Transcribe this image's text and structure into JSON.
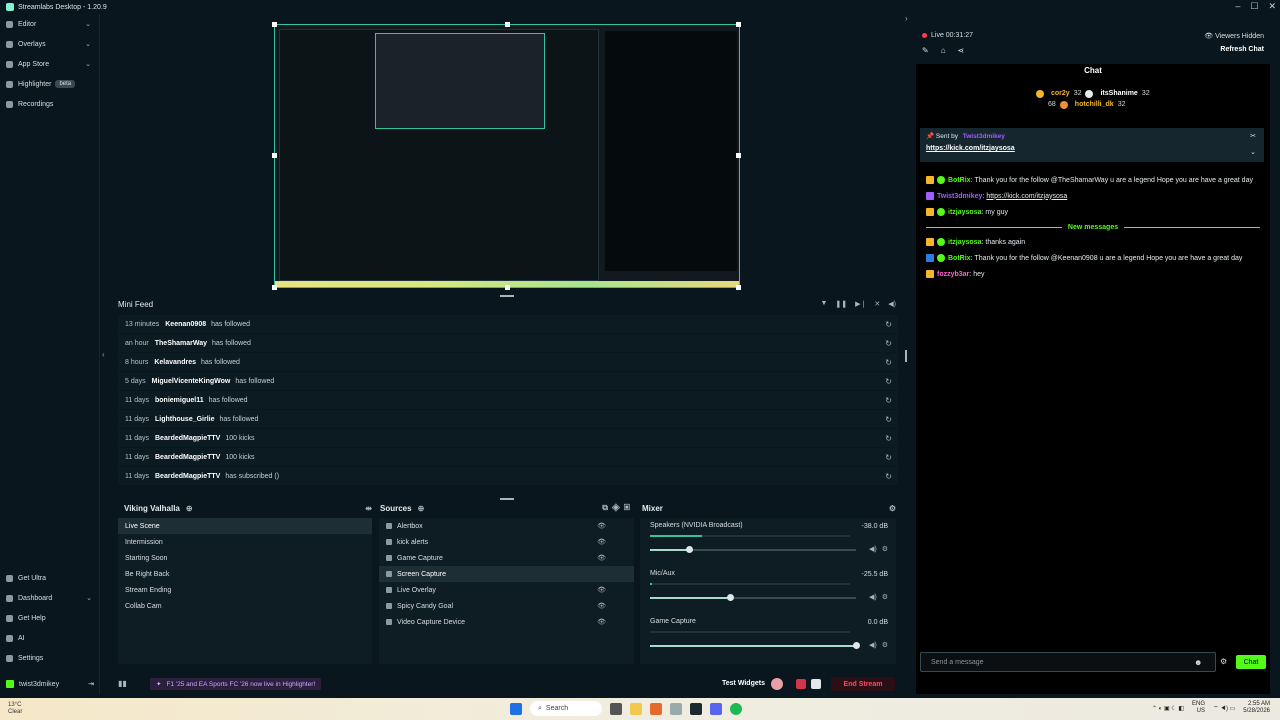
{
  "app": {
    "title": "Streamlabs Desktop - 1.20.9"
  },
  "sidebar": {
    "top": [
      {
        "label": "Editor",
        "chevron": true
      },
      {
        "label": "Overlays",
        "chevron": true
      },
      {
        "label": "App Store",
        "chevron": true
      },
      {
        "label": "Highlighter",
        "badge": "beta"
      },
      {
        "label": "Recordings"
      }
    ],
    "bottom": [
      {
        "label": "Get Ultra"
      },
      {
        "label": "Dashboard",
        "chevron": true
      },
      {
        "label": "Get Help"
      },
      {
        "label": "AI"
      },
      {
        "label": "Settings"
      }
    ],
    "user": "twist3dmikey"
  },
  "minifeed": {
    "title": "Mini Feed",
    "rows": [
      {
        "time": "13 minutes",
        "name": "Keenan0908",
        "action": "has followed"
      },
      {
        "time": "an hour",
        "name": "TheShamarWay",
        "action": "has followed"
      },
      {
        "time": "8 hours",
        "name": "Kelavandres",
        "action": "has followed"
      },
      {
        "time": "5 days",
        "name": "MiguelVicenteKingWow",
        "action": "has followed"
      },
      {
        "time": "11 days",
        "name": "boniemiguel11",
        "action": "has followed"
      },
      {
        "time": "11 days",
        "name": "Lighthouse_Girlie",
        "action": "has followed"
      },
      {
        "time": "11 days",
        "name": "BeardedMagpieTTV",
        "action": "100 kicks"
      },
      {
        "time": "11 days",
        "name": "BeardedMagpieTTV",
        "action": "100 kicks"
      },
      {
        "time": "11 days",
        "name": "BeardedMagpieTTV",
        "action": "has subscribed ()"
      }
    ]
  },
  "scenes": {
    "title": "Viking Valhalla",
    "items": [
      "Live Scene",
      "Intermission",
      "Starting Soon",
      "Be Right Back",
      "Stream Ending",
      "Collab Cam"
    ],
    "selected": 0
  },
  "sources": {
    "title": "Sources",
    "items": [
      "Alertbox",
      "kick alerts",
      "Game Capture",
      "Screen Capture",
      "Live Overlay",
      "Spicy Candy Goal",
      "Video Capture Device"
    ],
    "selected": 3
  },
  "mixer": {
    "title": "Mixer",
    "items": [
      {
        "name": "Speakers (NVIDIA Broadcast)",
        "db": "-38.0 dB",
        "level": 0.26,
        "volume": 0.19
      },
      {
        "name": "Mic/Aux",
        "db": "-25.5 dB",
        "level": 0.01,
        "volume": 0.39
      },
      {
        "name": "Game Capture",
        "db": "0.0 dB",
        "level": 0.0,
        "volume": 1.0
      }
    ]
  },
  "footer": {
    "banner": "F1 '25 and EA Sports FC '26 now live in Highlighter!",
    "test_widgets": "Test Widgets",
    "end_stream": "End Stream"
  },
  "chat": {
    "live": "Live 00:31:27",
    "viewers": "Viewers Hidden",
    "refresh": "Refresh Chat",
    "title": "Chat",
    "leaders": [
      {
        "name": "cor2y",
        "value": "32",
        "name2": "itsShanime",
        "value2": "32"
      },
      {
        "name": "",
        "value": "68",
        "name2": "hotchilli_dk",
        "value2": "32"
      }
    ],
    "pinned_by_label": "Sent by",
    "pinned_by": "Twist3dmikey",
    "pinned_link": "https://kick.com/itzjaysosa",
    "messages": [
      {
        "user": "BotRix",
        "text": "Thank you for the follow @TheShamarWay u are a legend Hope you are have a great day",
        "color": "green"
      },
      {
        "user": "Twist3dmikey",
        "text": "https://kick.com/itzjaysosa",
        "color": "purple",
        "link": true
      },
      {
        "user": "itzjaysosa",
        "text": "my guy",
        "color": "green"
      }
    ],
    "new_messages_label": "New messages",
    "messages_new": [
      {
        "user": "itzjaysosa",
        "text": "thanks again",
        "color": "green"
      },
      {
        "user": "BotRix",
        "text": "Thank you for the follow @Keenan0908 u are a legend Hope you are have a great day",
        "color": "green"
      },
      {
        "user": "fozzyb3ar",
        "text": "hey",
        "color": "pink"
      }
    ],
    "input_placeholder": "Send a message",
    "send": "Chat"
  },
  "taskbar": {
    "weather_temp": "13°C",
    "weather_desc": "Clear",
    "search": "Search",
    "lang": "ENG",
    "lang2": "US",
    "time": "2:55 AM",
    "date": "5/28/2026"
  },
  "colors": {
    "accent": "#31c3a2",
    "kick": "#53fc18",
    "danger": "#ff4a5d"
  }
}
